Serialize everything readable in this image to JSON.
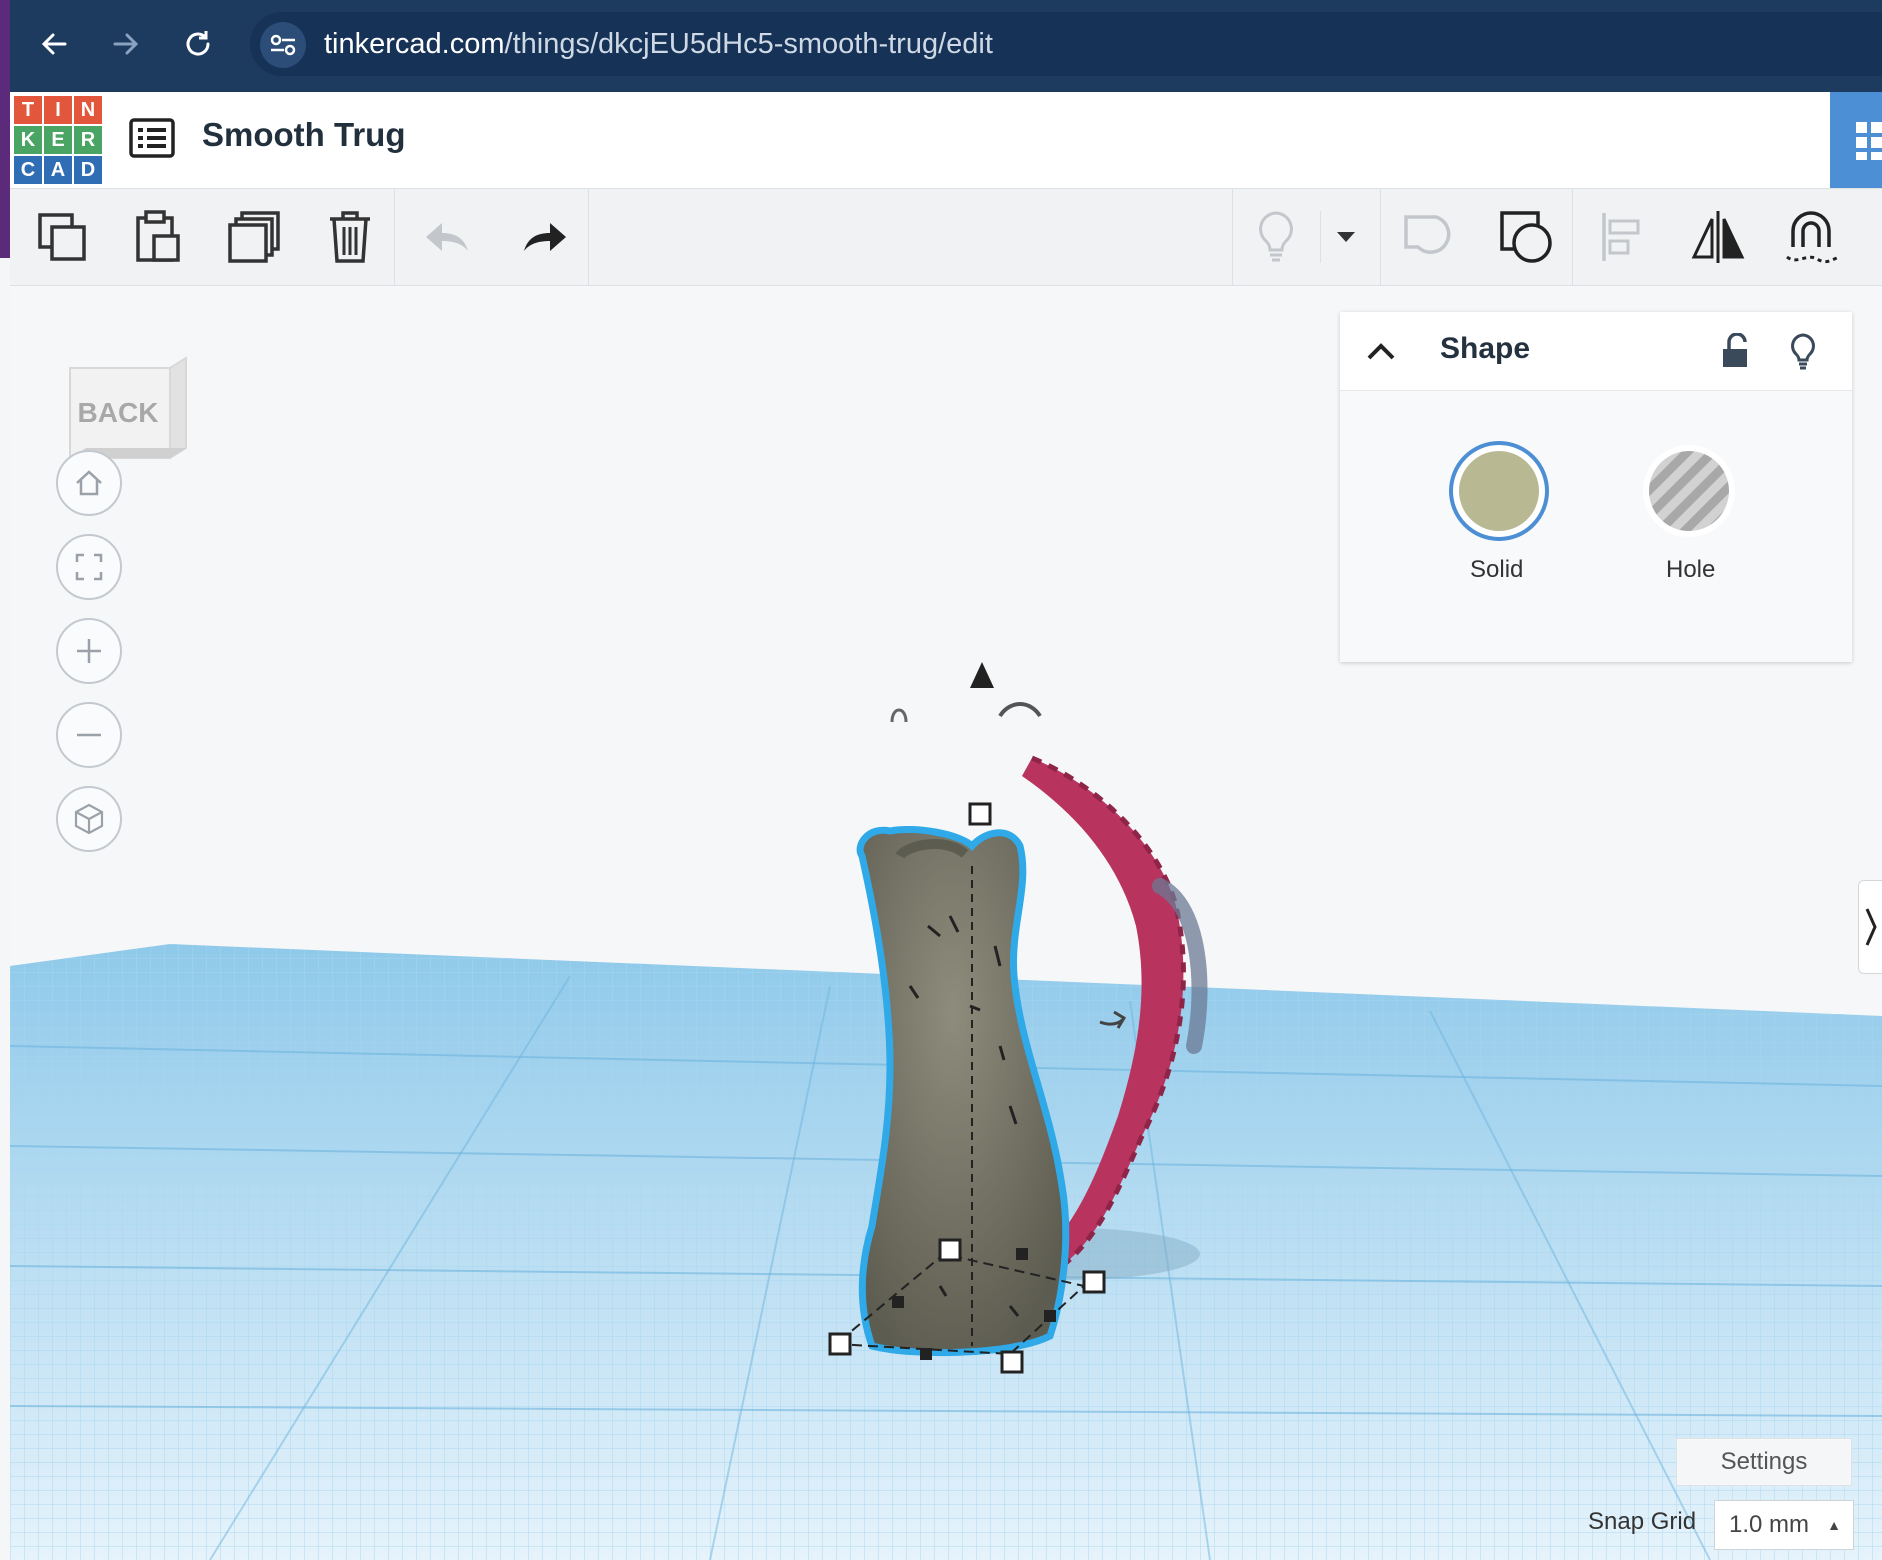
{
  "browser": {
    "url_host": "tinkercad.com",
    "url_path": "/things/dkcjEU5dHc5-smooth-trug/edit"
  },
  "app": {
    "logo_letters": [
      "T",
      "I",
      "N",
      "K",
      "E",
      "R",
      "C",
      "A",
      "D"
    ],
    "logo_colors": [
      "#e2563b",
      "#e2563b",
      "#e2563b",
      "#4aa564",
      "#4aa564",
      "#4aa564",
      "#2f6db5",
      "#2f6db5",
      "#2f6db5"
    ],
    "project_title": "Smooth Trug"
  },
  "view_cube": {
    "face_label": "BACK"
  },
  "shape_panel": {
    "title": "Shape",
    "solid_label": "Solid",
    "hole_label": "Hole",
    "solid_color": "#b8b892"
  },
  "footer": {
    "settings_label": "Settings",
    "snap_grid_label": "Snap Grid",
    "snap_grid_value": "1.0 mm"
  },
  "colors": {
    "grid": "#8fc9ea",
    "tail": "#b8345e",
    "cat_body": "#7a7a6a",
    "selection_outline": "#2fa9e8"
  }
}
